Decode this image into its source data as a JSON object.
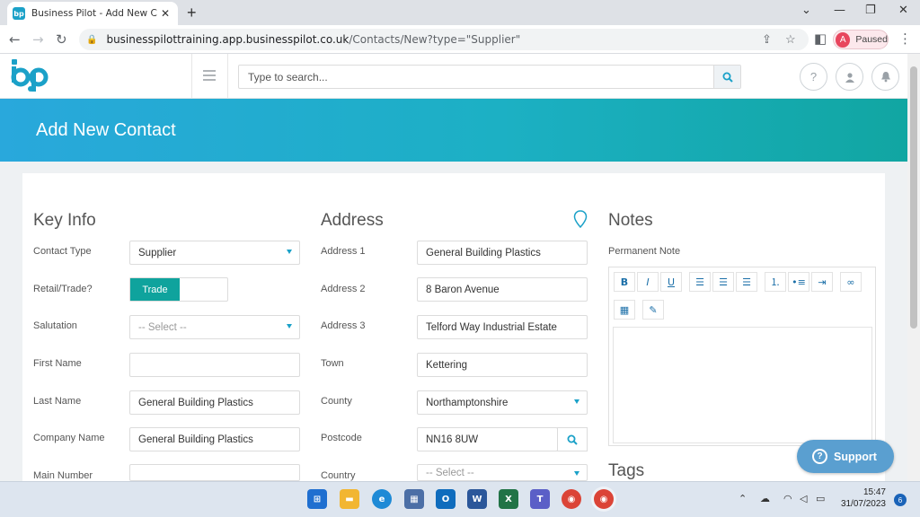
{
  "browser": {
    "tab_title": "Business Pilot - Add New Contac",
    "favicon_text": "bp",
    "url_host": "businesspilottraining.app.businesspilot.co.uk",
    "url_path": "/Contacts/New?type=\"Supplier\"",
    "profile_initial": "A",
    "profile_status": "Paused"
  },
  "header": {
    "search_placeholder": "Type to search..."
  },
  "page": {
    "title": "Add New Contact"
  },
  "key_info": {
    "title": "Key Info",
    "contact_type_label": "Contact Type",
    "contact_type_value": "Supplier",
    "retail_trade_label": "Retail/Trade?",
    "retail_trade_value": "Trade",
    "salutation_label": "Salutation",
    "salutation_placeholder": "-- Select --",
    "first_name_label": "First Name",
    "first_name_value": "",
    "last_name_label": "Last Name",
    "last_name_value": "General Building Plastics",
    "company_name_label": "Company Name",
    "company_name_value": "General Building Plastics",
    "main_number_label": "Main Number",
    "main_number_value": ""
  },
  "address": {
    "title": "Address",
    "address1_label": "Address 1",
    "address1_value": "General Building Plastics",
    "address2_label": "Address 2",
    "address2_value": "8 Baron Avenue",
    "address3_label": "Address 3",
    "address3_value": "Telford Way Industrial Estate",
    "town_label": "Town",
    "town_value": "Kettering",
    "county_label": "County",
    "county_value": "Northamptonshire",
    "postcode_label": "Postcode",
    "postcode_value": "NN16 8UW",
    "country_label": "Country",
    "country_placeholder": "-- Select --"
  },
  "notes": {
    "title": "Notes",
    "permanent_note_label": "Permanent Note",
    "toolbar": {
      "bold": "B",
      "italic": "I",
      "underline": "U"
    }
  },
  "tags": {
    "title": "Tags"
  },
  "support": {
    "label": "Support"
  },
  "taskbar": {
    "time": "15:47",
    "date": "31/07/2023",
    "notification_count": "6"
  },
  "colors": {
    "accent": "#1ba1c8",
    "teal": "#0fa39d",
    "support": "#5a9fd0"
  }
}
